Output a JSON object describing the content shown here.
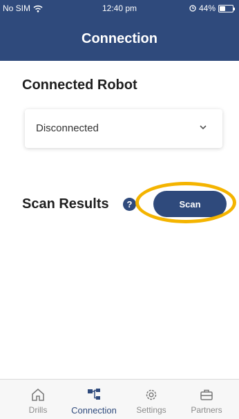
{
  "status_bar": {
    "carrier": "No SIM",
    "time": "12:40 pm",
    "battery": "44%",
    "battery_level": 0.44
  },
  "header": {
    "title": "Connection"
  },
  "connected_robot": {
    "heading": "Connected Robot",
    "dropdown_value": "Disconnected"
  },
  "scan": {
    "heading": "Scan Results",
    "help_symbol": "?",
    "button_label": "Scan"
  },
  "highlight_color": "#f4b400",
  "accent_color": "#2f4a7c",
  "tabs": [
    {
      "label": "Drills",
      "icon": "home-icon",
      "active": false
    },
    {
      "label": "Connection",
      "icon": "connection-icon",
      "active": true
    },
    {
      "label": "Settings",
      "icon": "gear-icon",
      "active": false
    },
    {
      "label": "Partners",
      "icon": "briefcase-icon",
      "active": false
    }
  ]
}
